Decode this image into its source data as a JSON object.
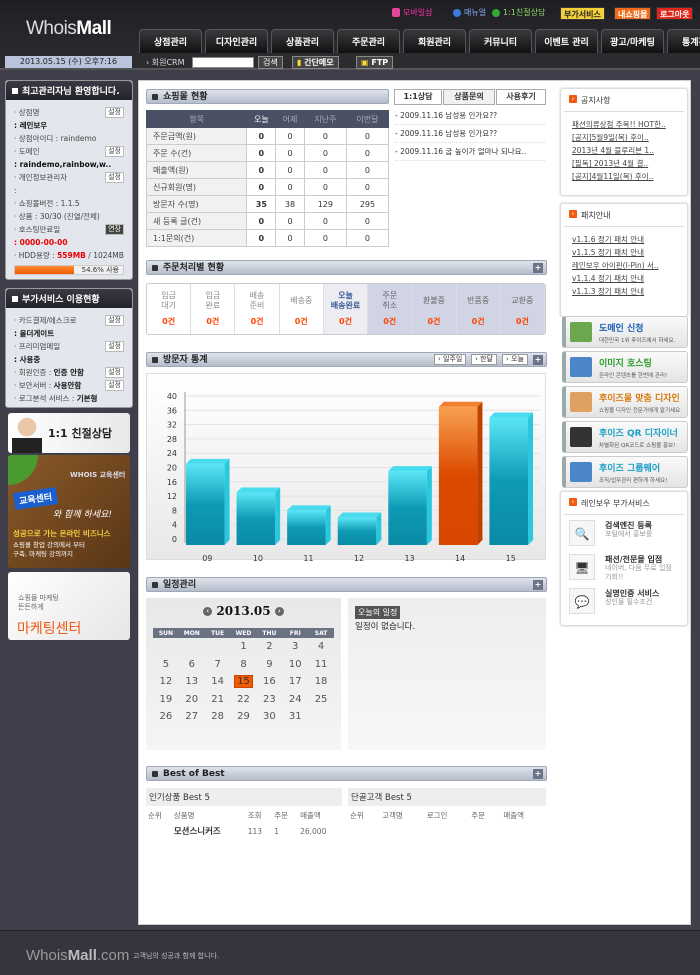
{
  "header": {
    "logo_light": "Whois",
    "logo_bold": "Mall",
    "links": [
      "모바일샵",
      "매뉴얼",
      "1:1친절상담"
    ],
    "buttons": [
      "부가서비스",
      "내쇼핑몰",
      "로그아웃"
    ],
    "menu": [
      "상점관리",
      "디자인관리",
      "상품관리",
      "주문관리",
      "회원관리",
      "커뮤니티",
      "이벤트 관리",
      "광고/마케팅",
      "통계관리"
    ]
  },
  "subbar": {
    "date": "2013.05.15 (수) 오후7:16",
    "crm_label": "› 회원CRM",
    "crm_value": "",
    "search": "검색",
    "memo": "간단메모",
    "ftp": "FTP"
  },
  "welcome": {
    "title": "최고관리자님 환영합니다.",
    "set": "설정",
    "extend": "연장",
    "shop_name_label": "· 상점명",
    "shop_name": ": 레인보우",
    "shop_id": "· 상점아이디 : raindemo",
    "domain_label": "· 도메인",
    "domain": ": raindemo,rainbow,w..",
    "privacy_label": "· 개인정보관리자",
    "privacy": ":",
    "version": "· 쇼핑몰버전 : 1.1.5",
    "products_label": "· 상품 : ",
    "products": "30/30 (진열/전체)",
    "hosting_label": "· 호스팅만료일",
    "hosting": ": 0000-00-00",
    "hdd_label": "· HDD용량 : ",
    "hdd_used": "559MB",
    "hdd_total": " / 1024MB",
    "hdd_percent": 54.6,
    "hdd_text": "54.6% 사용"
  },
  "addon": {
    "title": "부가서비스 이용현황",
    "rows": [
      {
        "label": "· 카드결제/에스크로",
        "value": ": 올더게이트",
        "set": true
      },
      {
        "label": "· 프리미엄메일",
        "value": ": 사용중",
        "set": true
      },
      {
        "label": "· 회원인증 : ",
        "value": "인증 안함",
        "set": true,
        "inline": true
      },
      {
        "label": "· 보안서버 : ",
        "value": "사용안함",
        "set": true,
        "inline": true
      },
      {
        "label": "· 로그분석 서비스 : ",
        "value": "기본형",
        "set": false,
        "inline": true
      }
    ]
  },
  "left_banners": {
    "consult": "1:1 친절상담",
    "edu_brand": "WHOIS 교육센터",
    "edu_tag": "교육센터",
    "edu_script": "와 함께 하세요!",
    "edu_head": "성공으로 가는 온라인 비즈니스",
    "edu_sub": "쇼핑몰 창업 강의에서 부터 구축, 마케팅 강의까지",
    "mkt_small1": "쇼핑몰 마케팅",
    "mkt_small2": "든든하게",
    "mkt_big": "마케팅센터"
  },
  "shop_status": {
    "title": "쇼핑몰 현황",
    "columns": [
      "항목",
      "오늘",
      "어제",
      "지난주",
      "이번달"
    ],
    "rows": [
      [
        "주문금액(원)",
        "0",
        "0",
        "0",
        "0"
      ],
      [
        "주문 수(건)",
        "0",
        "0",
        "0",
        "0"
      ],
      [
        "매출액(원)",
        "0",
        "0",
        "0",
        "0"
      ],
      [
        "신규회원(명)",
        "0",
        "0",
        "0",
        "0"
      ],
      [
        "방문자 수(명)",
        "35",
        "38",
        "129",
        "295"
      ],
      [
        "새 등록 글(건)",
        "0",
        "0",
        "0",
        "0"
      ],
      [
        "1:1문의(건)",
        "0",
        "0",
        "0",
        "0"
      ]
    ]
  },
  "qa": {
    "tabs": [
      "1:1상담",
      "상품문의",
      "사용후기"
    ],
    "active": 1,
    "items": [
      "- 2009.11.16 남성용 인가요??",
      "- 2009.11.16 남성용 인가요??",
      "- 2009.11.16 굽 높이가 얼마나 되나요.."
    ]
  },
  "orders": {
    "title": "주문처리별 현황",
    "steps": [
      {
        "l1": "입금",
        "l2": "대기",
        "c": "0건",
        "s": "w"
      },
      {
        "l1": "입금",
        "l2": "완료",
        "c": "0건",
        "s": "w"
      },
      {
        "l1": "배송",
        "l2": "준비",
        "c": "0건",
        "s": "w"
      },
      {
        "l1": "배송중",
        "l2": "",
        "c": "0건",
        "s": "w"
      },
      {
        "l1": "오늘",
        "l2": "배송완료",
        "c": "0건",
        "s": "t"
      },
      {
        "l1": "주문",
        "l2": "취소",
        "c": "0건",
        "s": "g"
      },
      {
        "l1": "환불중",
        "l2": "",
        "c": "0건",
        "s": "g"
      },
      {
        "l1": "반품중",
        "l2": "",
        "c": "0건",
        "s": "g"
      },
      {
        "l1": "교환중",
        "l2": "",
        "c": "0건",
        "s": "g"
      }
    ]
  },
  "visitors": {
    "title": "방문자 통계",
    "buttons": [
      "일주일",
      "한달",
      "오늘"
    ]
  },
  "chart_data": {
    "type": "bar",
    "categories": [
      "09",
      "10",
      "11",
      "12",
      "13",
      "14",
      "15"
    ],
    "values": [
      21,
      13,
      8,
      6,
      19,
      37,
      34
    ],
    "ylim": [
      0,
      40
    ],
    "yticks": [
      0,
      4,
      8,
      12,
      16,
      20,
      24,
      28,
      32,
      36,
      40
    ],
    "highlight": "14",
    "colors": {
      "normal": "#0e9ab5",
      "highlight": "#e05a10"
    },
    "grid": true
  },
  "schedule": {
    "title": "일정관리",
    "month": "2013.05",
    "days": [
      "SUN",
      "MON",
      "TUE",
      "WED",
      "THU",
      "FRI",
      "SAT"
    ],
    "first_weekday": 3,
    "days_in_month": 31,
    "today": 15,
    "today_label": "오늘의 일정",
    "empty": "일정이 없습니다."
  },
  "best": {
    "title": "Best of Best",
    "popular": {
      "caption": "인기상품 Best 5",
      "columns": [
        "순위",
        "상품명",
        "조회",
        "주문",
        "매출액"
      ],
      "rows": [
        [
          "",
          "모션스니커즈",
          "113",
          "1",
          "26,000"
        ]
      ]
    },
    "customers": {
      "caption": "단골고객 Best 5",
      "columns": [
        "순위",
        "고객명",
        "로그인",
        "주문",
        "매출액"
      ],
      "rows": []
    }
  },
  "notice": {
    "title": "공지사항",
    "items": [
      "패션의류상점 주목!! HOT한..",
      "[공지]5월9일(목) 후이..",
      "2013년 4월 블루리본 1..",
      "[필독] 2013년 4월 결..",
      "[공지]4월11일(목) 후이.."
    ]
  },
  "patch": {
    "title": "패치안내",
    "items": [
      "v1.1.6 정기 패치 안내",
      "v1.1.5 정기 패치 안내",
      "레인보우 아이핀(I-Pin) 서..",
      "v1.1.4 정기 패치 안내",
      "v1.1.3 정기 패치 안내"
    ]
  },
  "promo": [
    {
      "t": "도메인 신청",
      "s": "대한민국 1위 후이즈에서 하세요.",
      "c": "#1a5fb4"
    },
    {
      "t": "이미지 호스팅",
      "s": "온라인 콘텐츠를 한번에 관리!",
      "c": "#2a9a2a"
    },
    {
      "t": "후이즈몰 맞춤 디자인",
      "s": "쇼핑몰 디자인 전문가에게 맡기세요",
      "c": "#d87a10"
    },
    {
      "t": "후이즈 QR 디자이너",
      "s": "차별화된 QR코드로 쇼핑몰 홍보!",
      "c": "#1aa0c8"
    },
    {
      "t": "후이즈 그룹웨어",
      "s": "조직/업무관리 편하게 하세요!",
      "c": "#1aa0c8"
    }
  ],
  "services": {
    "title": "레인보우 부가서비스",
    "items": [
      {
        "t": "검색엔진 등록",
        "s": "포털에서 홍보를"
      },
      {
        "t": "패션/전문몰 입점",
        "s": "네이버, 다음 무료 입점 기회!!"
      },
      {
        "t": "실명인증 서비스",
        "s": "성인몰 필수조건"
      }
    ]
  },
  "footer": {
    "logo_light": "Whois",
    "logo_bold": "Mall",
    "logo_tail": ".com",
    "slogan": "고객님의 성공과 함께 합니다."
  }
}
